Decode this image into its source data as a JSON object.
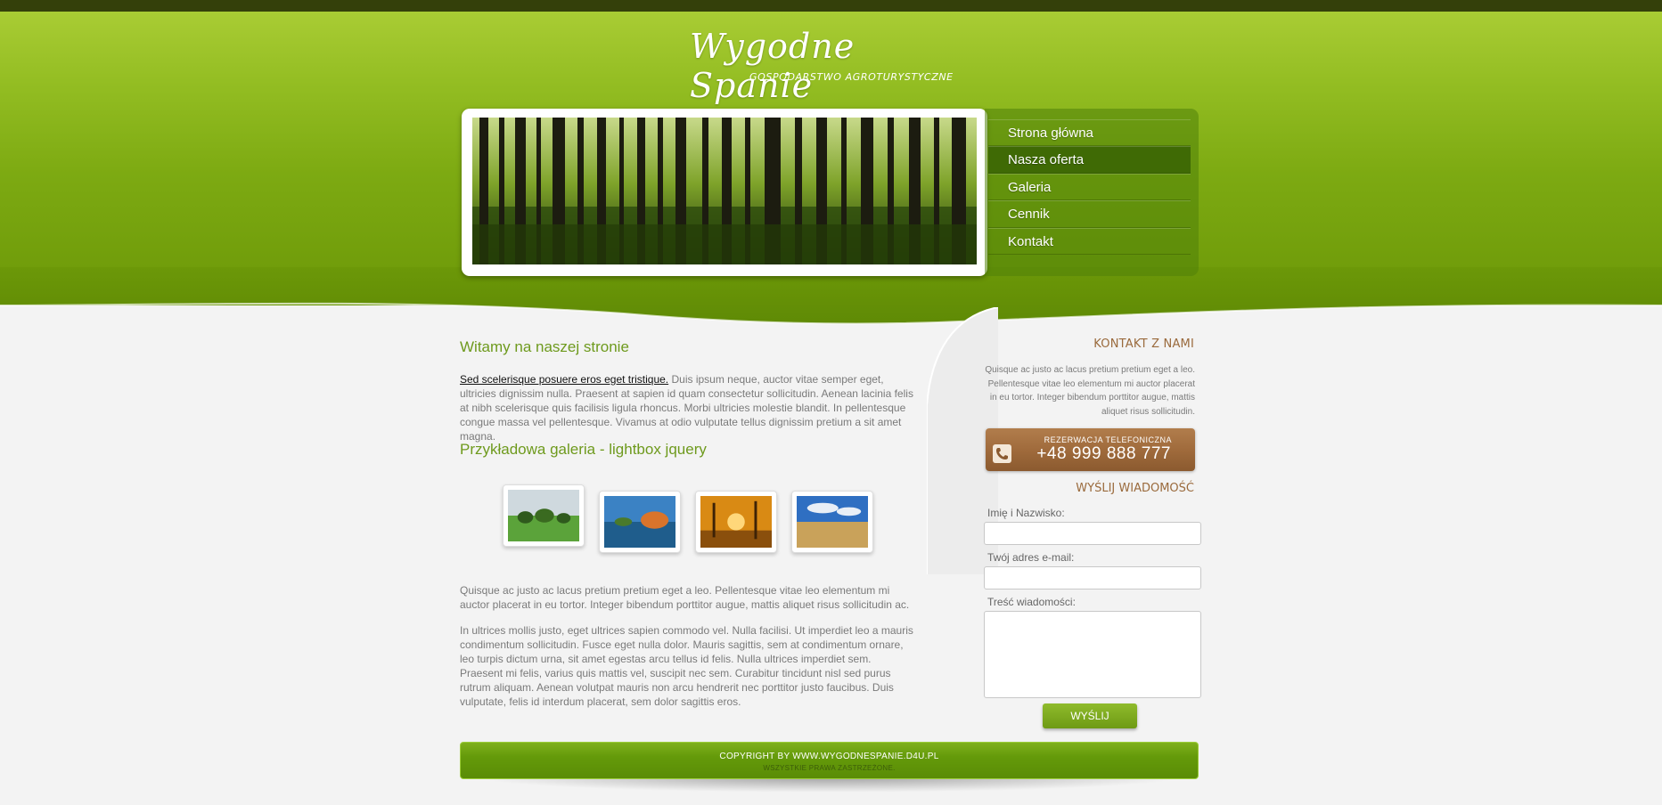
{
  "logo": {
    "title": "Wygodne Spanie",
    "subtitle": "GOSPODARSTWO AGROTURYSTYCZNE"
  },
  "nav": {
    "items": [
      {
        "label": "Strona główna"
      },
      {
        "label": "Nasza oferta"
      },
      {
        "label": "Galeria"
      },
      {
        "label": "Cennik"
      },
      {
        "label": "Kontakt"
      }
    ],
    "active": "Nasza oferta"
  },
  "main": {
    "welcome_heading": "Witamy na naszej stronie",
    "intro_link": "Sed scelerisque posuere eros eget tristique.",
    "intro_text": " Duis ipsum neque, auctor vitae semper eget, ultricies dignissim nulla. Praesent at sapien id quam consectetur sollicitudin. Aenean lacinia felis at nibh scelerisque quis facilisis ligula rhoncus. Morbi ultricies molestie blandit. In pellentesque congue massa vel pellentesque. Vivamus at odio vulputate tellus dignissim pretium a sit amet magna.",
    "gallery_heading": "Przykładowa galeria - lightbox jquery",
    "paragraph1": "Quisque ac justo ac lacus pretium pretium eget a leo. Pellentesque vitae leo elementum mi auctor placerat in eu tortor. Integer bibendum porttitor augue, mattis aliquet risus sollicitudin ac.",
    "paragraph2": "In ultrices mollis justo, eget ultrices sapien commodo vel. Nulla facilisi. Ut imperdiet leo a mauris condimentum sollicitudin. Fusce eget nulla dolor. Mauris sagittis, sem at condimentum ornare, leo turpis dictum urna, sit amet egestas arcu tellus id felis. Nulla ultrices imperdiet sem. Praesent mi felis, varius quis mattis vel, suscipit nec sem. Curabitur tincidunt nisl sed purus rutrum aliquam. Aenean volutpat mauris non arcu hendrerit nec porttitor justo faucibus. Duis vulputate, felis id interdum placerat, sem dolor sagittis eros."
  },
  "sidebar": {
    "contact_title": "KONTAKT Z NAMI",
    "contact_text": "Quisque ac justo ac lacus pretium pretium eget a leo. Pellentesque vitae leo elementum mi auctor placerat in eu tortor. Integer bibendum porttitor augue, mattis aliquet risus sollicitudin.",
    "phone_label": "REZERWACJA TELEFONICZNA",
    "phone_number": "+48 999 888 777",
    "send_title": "WYŚLIJ WIADOMOŚĆ",
    "name_label": "Imię i Nazwisko:",
    "email_label": "Twój adres e-mail:",
    "message_label": "Treść wiadomości:",
    "send_button": "WYŚLIJ"
  },
  "footer": {
    "copyright": "COPYRIGHT BY WWW.WYGODNESPANIE.D4U.PL",
    "rights": "WSZYSTKIE PRAWA ZASTRZEŻONE."
  },
  "colors": {
    "header_green": "#7daa12",
    "heading_green": "#6e9a1d",
    "accent_brown": "#9a6a3c",
    "nav_active": "#3f6a05"
  }
}
